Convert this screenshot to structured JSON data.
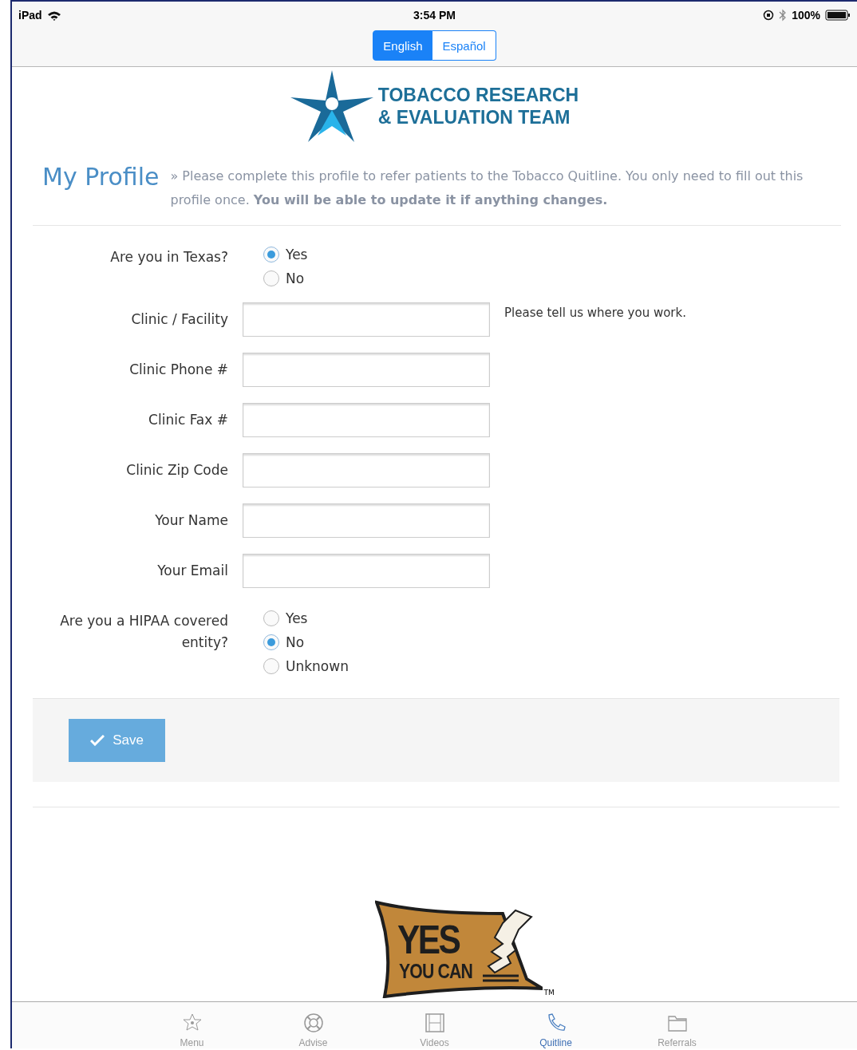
{
  "status_bar": {
    "device": "iPad",
    "time": "3:54 PM",
    "battery": "100%"
  },
  "language_toggle": [
    {
      "label": "English",
      "selected": true
    },
    {
      "label": "Español",
      "selected": false
    }
  ],
  "header_logo": {
    "line_1": "TOBACCO RESEARCH",
    "line_2": "& EVALUATION TEAM"
  },
  "page_title": "My Profile",
  "intro": "» Please complete this profile to refer patients to the Tobacco Quitline. You only need to fill out this profile once. **You will be able to update it if anything changes.**",
  "form": [
    {
      "kind": "radio",
      "label": "Are you in Texas?",
      "options": [
        {
          "label": "Yes",
          "selected": true
        },
        {
          "label": "No",
          "selected": false
        }
      ]
    },
    {
      "kind": "text",
      "label": "Clinic / Facility",
      "help": "Please tell us where you work."
    },
    {
      "kind": "text",
      "label": "Clinic Phone #"
    },
    {
      "kind": "text",
      "label": "Clinic Fax #"
    },
    {
      "kind": "text",
      "label": "Clinic Zip Code"
    },
    {
      "kind": "text",
      "label": "Your Name"
    },
    {
      "kind": "text",
      "label": "Your Email"
    },
    {
      "kind": "radio",
      "label": "Are you a HIPAA covered entity?",
      "options": [
        {
          "label": "Yes",
          "selected": false
        },
        {
          "label": "No",
          "selected": true
        },
        {
          "label": "Unknown",
          "selected": false
        }
      ]
    }
  ],
  "save_button": "Save",
  "footer_logo": {
    "line_1": "YES",
    "line_2": "YOU CAN",
    "mark": "TM"
  },
  "tab_bar": [
    {
      "label": "Menu",
      "selected": false
    },
    {
      "label": "Advise",
      "selected": false
    },
    {
      "label": "Videos",
      "selected": false
    },
    {
      "label": "Quitline",
      "selected": true
    },
    {
      "label": "Referrals",
      "selected": false
    }
  ]
}
